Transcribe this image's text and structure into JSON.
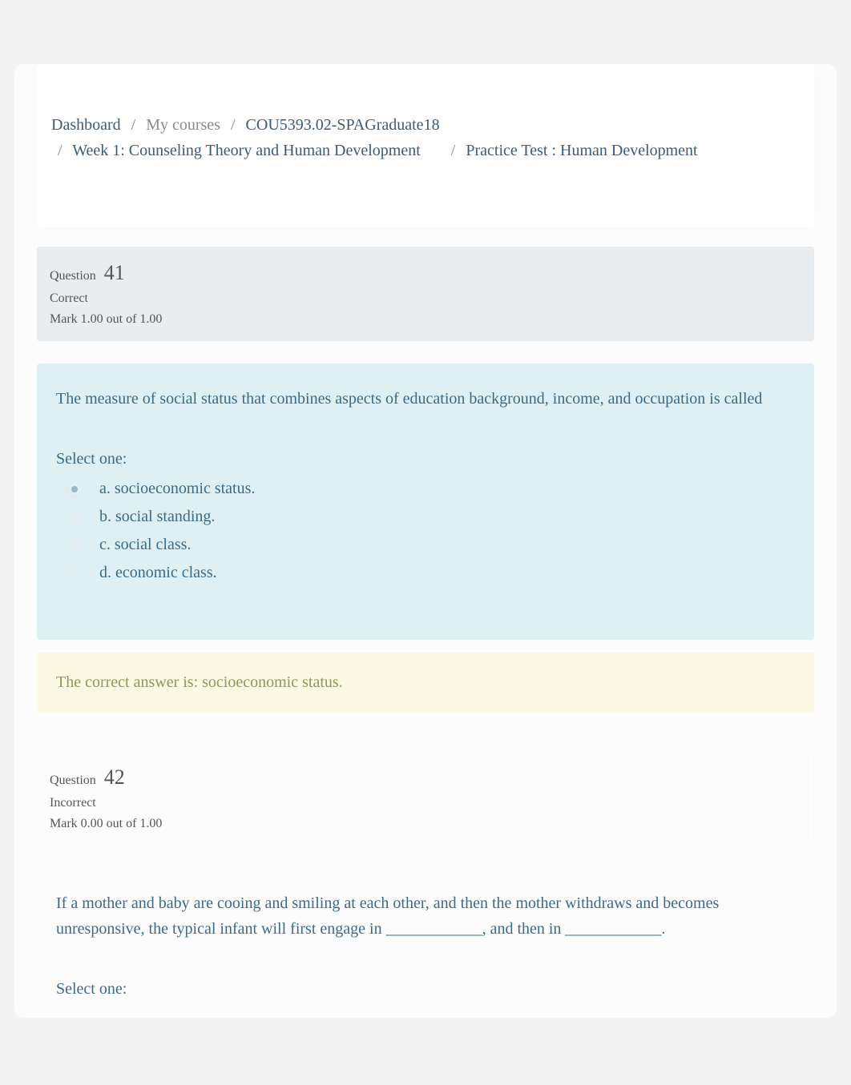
{
  "breadcrumb": {
    "dashboard": "Dashboard",
    "my_courses": "My courses",
    "course_code": "COU5393.02-SPAGraduate18",
    "week": "Week 1: Counseling Theory and Human Development",
    "activity": "Practice Test : Human Development"
  },
  "questions": [
    {
      "number_label": "Question",
      "number": "41",
      "state": "Correct",
      "mark": "Mark 1.00 out of 1.00",
      "text": "The measure of social status that combines aspects of education background, income, and occupation is called",
      "select_one": "Select one:",
      "answers": [
        {
          "label": "a. socioeconomic status.",
          "selected": true
        },
        {
          "label": "b. social standing.",
          "selected": false
        },
        {
          "label": "c. social class.",
          "selected": false
        },
        {
          "label": "d. economic class.",
          "selected": false
        }
      ],
      "feedback": "The correct answer is: socioeconomic status.",
      "shaded": true
    },
    {
      "number_label": "Question",
      "number": "42",
      "state": "Incorrect",
      "mark": "Mark 0.00 out of 1.00",
      "text": "If a mother and baby are cooing and smiling at each other, and then the mother withdraws and becomes unresponsive, the typical infant will first engage in ____________, and then in ____________.",
      "select_one": "Select one:",
      "answers": [],
      "feedback": "",
      "shaded": false
    }
  ]
}
